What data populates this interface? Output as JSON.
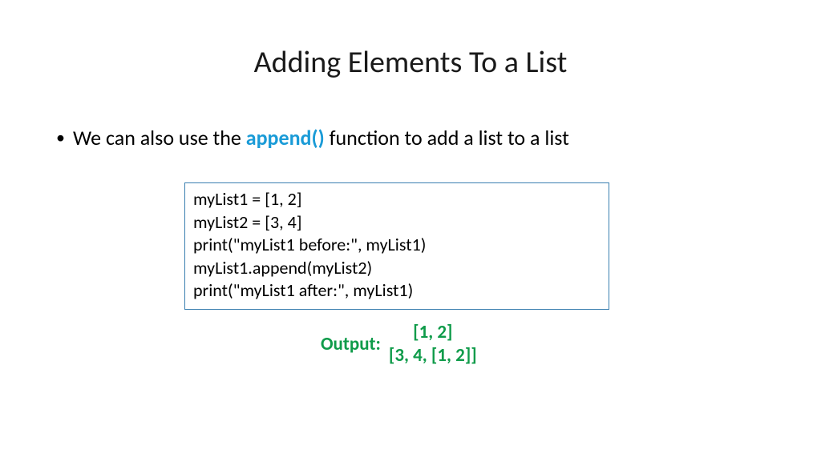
{
  "title": "Adding Elements To a List",
  "bullet": {
    "pre": "We can also use the ",
    "highlight": "append()",
    "post": " function to add a list to a list"
  },
  "code": {
    "l1": "myList1 = [1, 2]",
    "l2": "myList2 = [3, 4]",
    "l3": "print(\"myList1 before:\", myList1)",
    "l4": "myList1.append(myList2)",
    "l5": "print(\"myList1 after:\", myList1)"
  },
  "output": {
    "label": "Output:",
    "line1": "[1, 2]",
    "line2": "[3, 4, [1, 2]]"
  }
}
